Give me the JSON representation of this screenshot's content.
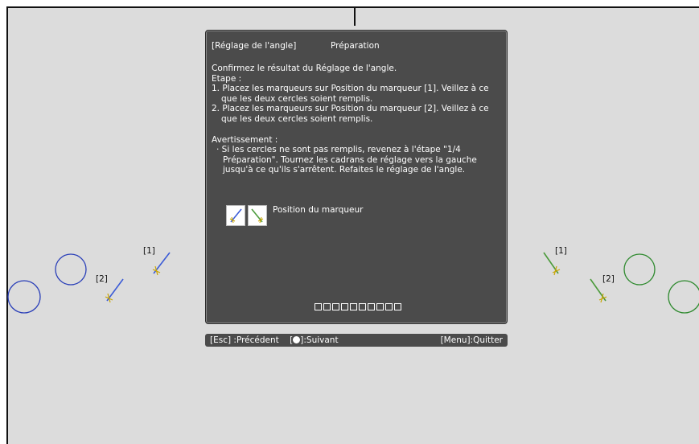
{
  "dialog": {
    "title": "[Réglage de l'angle]",
    "subtitle": "Préparation",
    "lines": [
      "Confirmez le résultat du Réglage de l'angle.",
      "Etape :"
    ],
    "steps": [
      "1. Placez les marqueurs sur Position du marqueur [1]. Veillez à ce que les deux cercles soient remplis.",
      "2. Placez les marqueurs sur Position du marqueur [2]. Veillez à ce que les deux cercles soient remplis."
    ],
    "warning_title": "Avertissement :",
    "warning_text": "· Si les cercles ne sont pas remplis, revenez à l'étape \"1/4 Préparation\". Tournez les cadrans de réglage vers la gauche jusqu'à ce qu'ils s'arrêtent. Refaites le réglage de l'angle.",
    "marker_label": "Position du marqueur",
    "progress_boxes": 10
  },
  "footer": {
    "back": "[Esc] :Précédent",
    "next_prefix": "[",
    "next_suffix": "]:Suivant",
    "quit": "[Menu]:Quitter"
  },
  "markers": {
    "left_1": "[1]",
    "left_2": "[2]",
    "right_1": "[1]",
    "right_2": "[2]"
  },
  "colors": {
    "left_circles": "#2a3fb8",
    "right_circles": "#2f8a2f",
    "left_marker": "#3b5bd6",
    "right_marker": "#4a9a3a",
    "marker_cross": "#c9a400"
  }
}
